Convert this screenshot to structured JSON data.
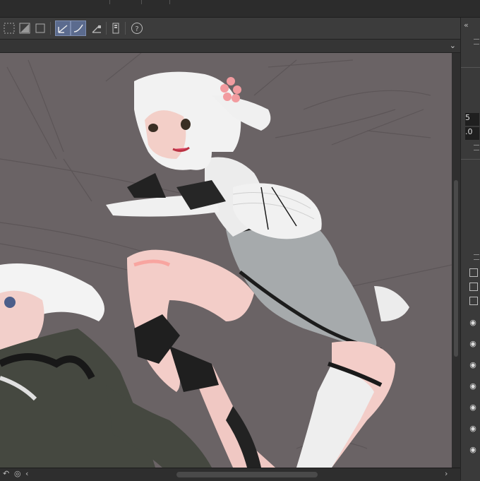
{
  "toolbar": {
    "buttons": [
      "select-grid-tool",
      "fill-tool",
      "frame-tool",
      "ruler-tool",
      "ruler-curve-tool",
      "perspective-tool",
      "device-tool",
      "help-tool"
    ],
    "active": "ruler-tool"
  },
  "right_panel": {
    "collapse_label": "«",
    "value_top": "5",
    "value_bottom": ".0"
  },
  "colors": {
    "canvas_bg": "#6a6365",
    "ui_dark": "#2c2c2c",
    "ui_mid": "#3c3c3c",
    "active_tool": "#5b6b8e"
  }
}
